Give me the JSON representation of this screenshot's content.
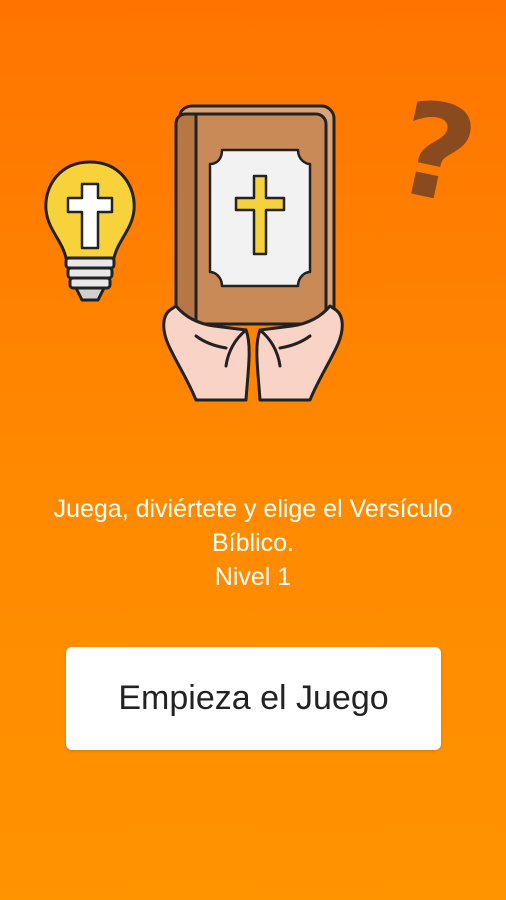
{
  "intro": {
    "line1": "Juega, diviértete y elige el Versículo",
    "line2": "Bíblico.",
    "level": "Nivel 1"
  },
  "start_button": {
    "label": "Empieza el Juego"
  },
  "icons": [
    "lightbulb-cross-icon",
    "bible-book-icon",
    "cross-icon",
    "open-hands-icon",
    "question-mark-icon"
  ],
  "colors": {
    "background_top": "#ff7400",
    "background_bottom": "#ff9300",
    "button_bg": "#ffffff",
    "book_cover": "#c98a58",
    "bulb": "#f7d23a",
    "question_mark": "#8a4a20"
  }
}
